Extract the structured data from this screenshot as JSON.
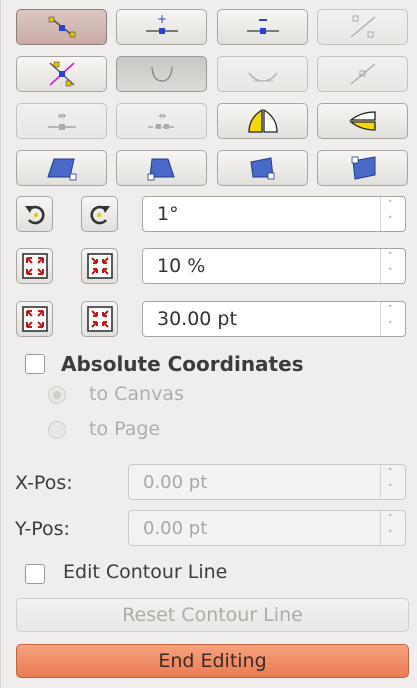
{
  "toolbar": {
    "rows": [
      [
        "move-points",
        "insert-points",
        "delete-points",
        "split-curve"
      ],
      [
        "convert-to-curve",
        "smooth-transition",
        "symmetric-transition",
        "close-bezier"
      ],
      [
        "eliminate-points",
        "reduce-points",
        "rotate-mode",
        "shear-mode"
      ],
      [
        "distort-mode",
        "set-perspective",
        "set-to-circle",
        "transparency-mode"
      ]
    ]
  },
  "rotation": {
    "value": "1°"
  },
  "scale": {
    "value": "10 %"
  },
  "distance": {
    "value": "30.00 pt"
  },
  "absolute_coordinates": {
    "label": "Absolute Coordinates",
    "checked": false,
    "options": [
      {
        "label": "to Canvas",
        "selected": true
      },
      {
        "label": "to Page",
        "selected": false
      }
    ]
  },
  "position": {
    "x_label": "X-Pos:",
    "x_value": "0.00 pt",
    "y_label": "Y-Pos:",
    "y_value": "0.00 pt"
  },
  "contour": {
    "edit_label": "Edit Contour Line",
    "edit_checked": false,
    "reset_label": "Reset Contour Line"
  },
  "end_editing_label": "End Editing",
  "colors": {
    "accent": "#ea7b52",
    "active_tool": "#c9aba5"
  }
}
